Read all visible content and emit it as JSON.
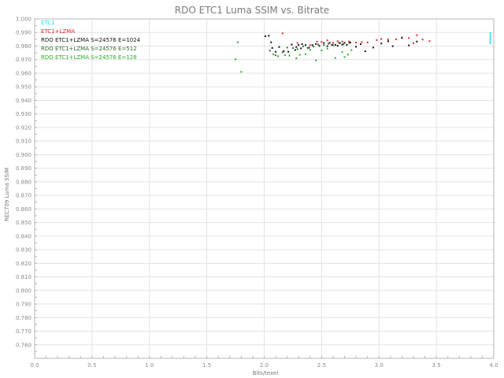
{
  "chart_data": {
    "type": "scatter",
    "title": "RDO ETC1 Luma SSIM vs. Bitrate",
    "xlabel": "Bits/texel",
    "ylabel": "REC709 Luma SSIM",
    "xlim": [
      0.0,
      4.0
    ],
    "ylim": [
      0.75,
      1.0
    ],
    "xticks": [
      "0.0",
      "0.5",
      "1.0",
      "1.5",
      "2.0",
      "2.5",
      "3.0",
      "3.5",
      "4.0"
    ],
    "yticks": [
      "1.000",
      "0.990",
      "0.980",
      "0.970",
      "0.960",
      "0.950",
      "0.940",
      "0.930",
      "0.920",
      "0.910",
      "0.900",
      "0.890",
      "0.880",
      "0.870",
      "0.860",
      "0.850",
      "0.840",
      "0.830",
      "0.820",
      "0.810",
      "0.800",
      "0.790",
      "0.780",
      "0.770",
      "0.760"
    ],
    "grid": true,
    "legend_position": "top-left",
    "series": [
      {
        "name": "ETC1",
        "color": "#22ddee",
        "points": [
          [
            3.97,
            0.9895
          ],
          [
            3.97,
            0.988
          ],
          [
            3.97,
            0.9865
          ],
          [
            3.97,
            0.985
          ],
          [
            3.97,
            0.9835
          ],
          [
            3.97,
            0.982
          ]
        ]
      },
      {
        "name": "ETC1+LZMA",
        "color": "#e8262b",
        "points": [
          [
            2.16,
            0.9894
          ],
          [
            2.29,
            0.9823
          ],
          [
            2.4,
            0.9806
          ],
          [
            2.46,
            0.9832
          ],
          [
            2.5,
            0.983
          ],
          [
            2.55,
            0.9842
          ],
          [
            2.6,
            0.9823
          ],
          [
            2.64,
            0.9836
          ],
          [
            2.68,
            0.9833
          ],
          [
            2.74,
            0.9834
          ],
          [
            2.8,
            0.9826
          ],
          [
            2.85,
            0.9829
          ],
          [
            2.9,
            0.9827
          ],
          [
            2.98,
            0.9844
          ],
          [
            3.02,
            0.9852
          ],
          [
            3.08,
            0.9848
          ],
          [
            3.15,
            0.9849
          ],
          [
            3.2,
            0.9858
          ],
          [
            3.26,
            0.9859
          ],
          [
            3.3,
            0.9822
          ],
          [
            3.33,
            0.988
          ],
          [
            3.38,
            0.9848
          ],
          [
            3.44,
            0.9836
          ]
        ]
      },
      {
        "name": "RDO ETC1+LZMA S=24576 E=1024",
        "color": "#111111",
        "points": [
          [
            2.01,
            0.9872
          ],
          [
            2.04,
            0.9876
          ],
          [
            2.06,
            0.9828
          ],
          [
            2.07,
            0.9786
          ],
          [
            2.1,
            0.9758
          ],
          [
            2.13,
            0.9793
          ],
          [
            2.17,
            0.9763
          ],
          [
            2.21,
            0.9758
          ],
          [
            2.24,
            0.9811
          ],
          [
            2.27,
            0.9771
          ],
          [
            2.28,
            0.9793
          ],
          [
            2.3,
            0.9808
          ],
          [
            2.32,
            0.9783
          ],
          [
            2.33,
            0.9814
          ],
          [
            2.36,
            0.9807
          ],
          [
            2.39,
            0.9788
          ],
          [
            2.42,
            0.9807
          ],
          [
            2.45,
            0.9815
          ],
          [
            2.48,
            0.9801
          ],
          [
            2.52,
            0.9823
          ],
          [
            2.55,
            0.9799
          ],
          [
            2.57,
            0.9824
          ],
          [
            2.59,
            0.9809
          ],
          [
            2.62,
            0.9809
          ],
          [
            2.64,
            0.9802
          ],
          [
            2.66,
            0.9822
          ],
          [
            2.68,
            0.9811
          ],
          [
            2.7,
            0.9824
          ],
          [
            2.72,
            0.9809
          ],
          [
            2.75,
            0.9826
          ],
          [
            2.8,
            0.9795
          ],
          [
            2.84,
            0.9814
          ],
          [
            2.88,
            0.9762
          ],
          [
            2.95,
            0.9789
          ],
          [
            3.02,
            0.9819
          ],
          [
            3.08,
            0.9835
          ],
          [
            3.12,
            0.9799
          ],
          [
            3.2,
            0.9862
          ],
          [
            3.26,
            0.9805
          ],
          [
            3.33,
            0.9833
          ]
        ]
      },
      {
        "name": "RDO ETC1+LZMA S=24576 E=512",
        "color": "#2e6b2e",
        "points": [
          [
            2.05,
            0.9766
          ],
          [
            2.1,
            0.9732
          ],
          [
            2.16,
            0.9754
          ],
          [
            2.2,
            0.9789
          ],
          [
            2.25,
            0.9785
          ],
          [
            2.29,
            0.9777
          ],
          [
            2.34,
            0.9798
          ],
          [
            2.38,
            0.9786
          ],
          [
            2.43,
            0.9797
          ],
          [
            2.47,
            0.9812
          ],
          [
            2.52,
            0.9808
          ],
          [
            2.56,
            0.9817
          ],
          [
            2.6,
            0.9806
          ],
          [
            2.65,
            0.9823
          ],
          [
            2.69,
            0.9813
          ],
          [
            2.74,
            0.9824
          ]
        ]
      },
      {
        "name": "RDO ETC1+LZMA S=24576 E=128",
        "color": "#27b027",
        "points": [
          [
            1.75,
            0.9703
          ],
          [
            1.77,
            0.9828
          ],
          [
            1.8,
            0.961
          ],
          [
            2.08,
            0.9738
          ],
          [
            2.12,
            0.9725
          ],
          [
            2.18,
            0.9732
          ],
          [
            2.22,
            0.973
          ],
          [
            2.28,
            0.971
          ],
          [
            2.31,
            0.9735
          ],
          [
            2.36,
            0.974
          ],
          [
            2.4,
            0.9772
          ],
          [
            2.45,
            0.9695
          ],
          [
            2.5,
            0.9768
          ],
          [
            2.55,
            0.9781
          ],
          [
            2.62,
            0.9712
          ],
          [
            2.68,
            0.9755
          ],
          [
            2.7,
            0.9719
          ],
          [
            2.73,
            0.9737
          ],
          [
            2.76,
            0.977
          ]
        ]
      }
    ]
  }
}
